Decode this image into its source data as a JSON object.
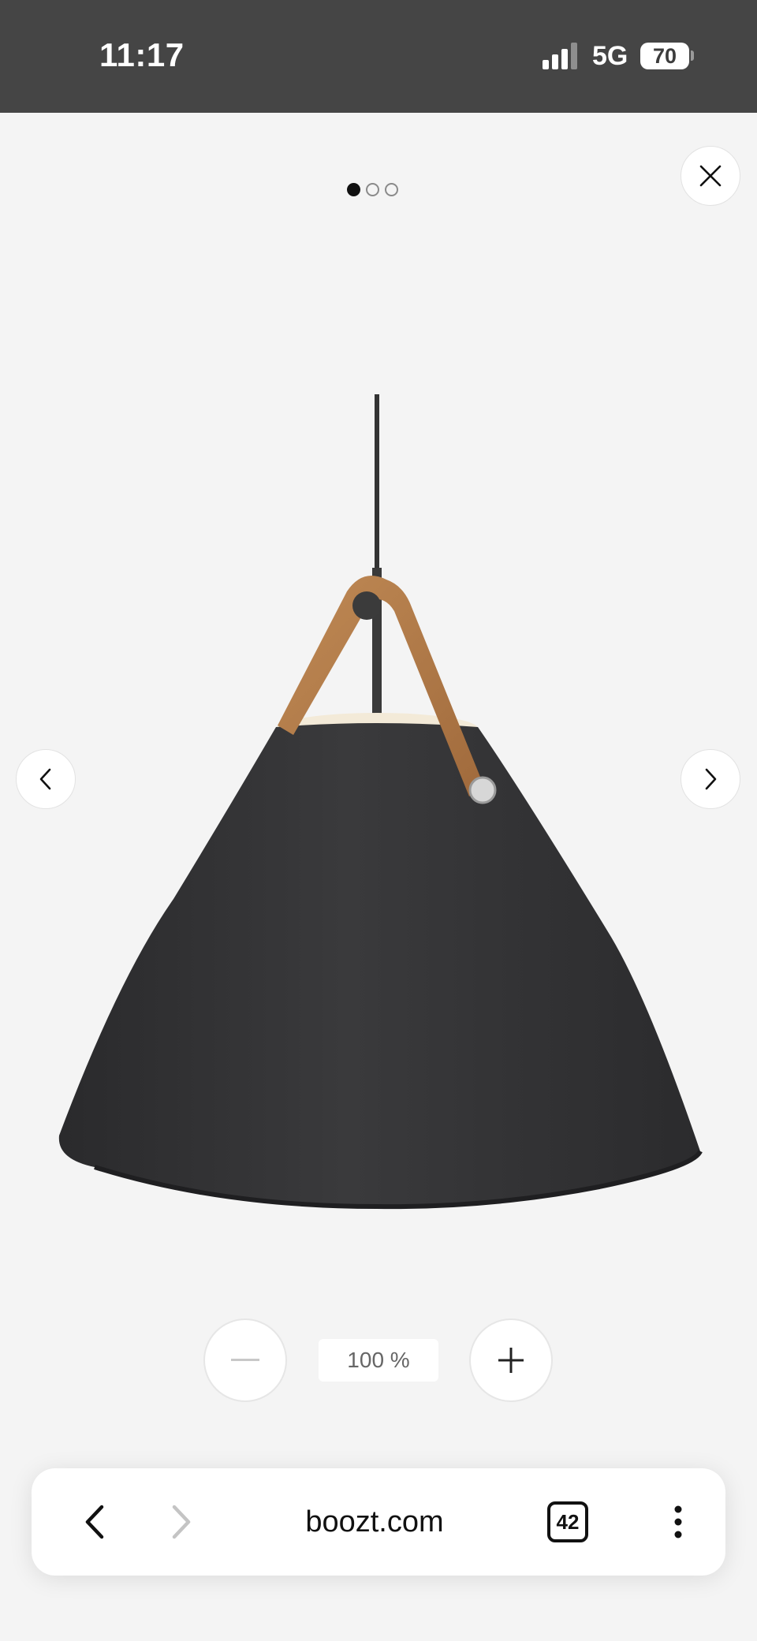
{
  "status_bar": {
    "time": "11:17",
    "network": "5G",
    "battery": "70",
    "icons": [
      "signal-icon",
      "battery-icon"
    ]
  },
  "gallery": {
    "pager": {
      "total": 3,
      "active_index": 0
    },
    "icons": [
      "close-icon",
      "chevron-left-icon",
      "chevron-right-icon"
    ],
    "image": "black-pendant-lamp-with-leather-strap"
  },
  "zoom": {
    "level_label": "100 %",
    "icons": [
      "minus-icon",
      "plus-icon"
    ]
  },
  "browser_toolbar": {
    "url": "boozt.com",
    "tab_count": "42",
    "icons": [
      "back-arrow-icon",
      "forward-arrow-icon",
      "tabs-icon",
      "more-vertical-icon"
    ]
  },
  "colors": {
    "status_bar": "#454545",
    "page_background": "#f4f4f4",
    "lamp_shade": "#2f2f31",
    "leather_strap": "#b07a47"
  }
}
